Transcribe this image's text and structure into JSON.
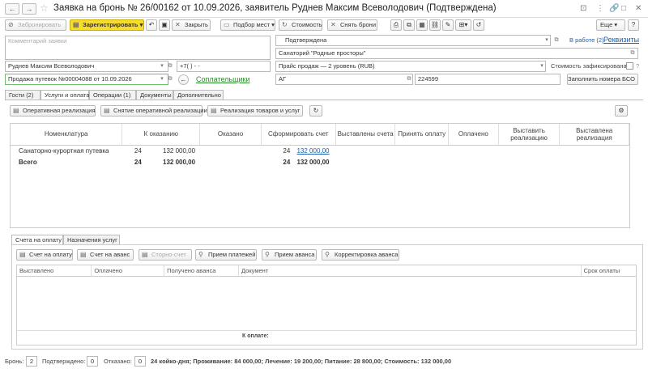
{
  "window": {
    "title": "Заявка на бронь № 26/00162 от 10.09.2026, заявитель Руднев Максим Всеволодович (Подтверждена)",
    "back": "←",
    "forward": "→",
    "star": "☆",
    "controls": [
      "⊡",
      "⋮",
      "🔗",
      "□",
      "✕"
    ]
  },
  "toolbar": {
    "reserve": "Забронировать",
    "register": "Зарегистрировать",
    "close": "Закрыть",
    "pick_places": "Подбор мест",
    "cost": "Стоимость",
    "remove_reservation": "Снять брони",
    "more": "Еще",
    "help": "?"
  },
  "form": {
    "comment_placeholder": "Комментарий заявки",
    "status": "Подтверждена",
    "in_work": "В работе (2)",
    "requisites": "Реквизиты",
    "sanatorium": "Санаторий \"Родные просторы\"",
    "price_list": "Прайс продаж — 2 уровень (RUB)",
    "cost_fixed_label": "Стоимость зафиксирована:",
    "applicant": "Руднев Максим Всеволодович",
    "phone": "+7(   )   -   -",
    "sale": "Продажа путевок №00004088 от 10.09.2026",
    "payers_link": "Соплательщики",
    "ag": "АГ",
    "number": "224599",
    "fill_bso": "Заполнить номера БСО"
  },
  "main_tabs": [
    {
      "label": "Гости (2)",
      "active": false
    },
    {
      "label": "Услуги и оплата",
      "active": true
    },
    {
      "label": "Операции (1)",
      "active": false
    },
    {
      "label": "Документы",
      "active": false
    },
    {
      "label": "Дополнительно",
      "active": false
    }
  ],
  "services_toolbar": {
    "operative": "Оперативная реализация",
    "cancel_operative": "Снятие оперативной реализации",
    "sale_goods": "Реализация товаров и услуг"
  },
  "services_table": {
    "headers": [
      "Номенклатура",
      "К оказанию",
      "Оказано",
      "Сформировать счет",
      "Выставлены счета",
      "Принять оплату",
      "Оплачено",
      "Выставить реализацию",
      "Выставлена реализация"
    ],
    "rows": [
      {
        "name": "Санаторно-курортная путевка",
        "qty": "24",
        "amount": "132 000,00",
        "invoice_qty": "24",
        "invoice_amount": "132 000,00"
      }
    ],
    "total": {
      "name": "Всего",
      "qty": "24",
      "amount": "132 000,00",
      "invoice_qty": "24",
      "invoice_amount": "132 000,00"
    }
  },
  "bottom_tabs": [
    {
      "label": "Счета на оплату",
      "active": true
    },
    {
      "label": "Назначения услуг",
      "active": false
    }
  ],
  "invoice_toolbar": {
    "invoice": "Счет на оплату",
    "advance_invoice": "Счет на аванс",
    "storno": "Сторно-счет",
    "payments": "Прием платежей",
    "advance_receipt": "Прием аванса",
    "advance_adjust": "Корректировка аванса"
  },
  "invoice_table": {
    "headers": [
      "Выставлено",
      "Оплачено",
      "Получено аванса",
      "Документ",
      "Срок оплаты"
    ],
    "to_pay": "К оплате:"
  },
  "footer": {
    "booking_label": "Бронь:",
    "booking_value": "2",
    "confirmed_label": "Подтверждено:",
    "confirmed_value": "0",
    "refused_label": "Отказано:",
    "refused_value": "0",
    "summary": "24 койко-дня; Проживание: 84 000,00; Лечение: 19 200,00; Питание: 28 800,00; Стоимость: 132 000,00"
  }
}
